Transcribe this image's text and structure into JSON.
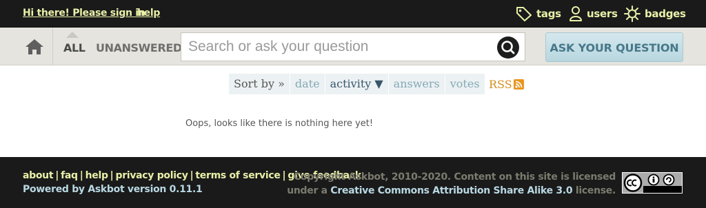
{
  "topbar": {
    "signin_label": "Hi there! Please sign in",
    "help_label": "help",
    "nav": [
      {
        "label": "tags",
        "icon": "tag-icon"
      },
      {
        "label": "users",
        "icon": "user-icon"
      },
      {
        "label": "badges",
        "icon": "badge-icon"
      }
    ]
  },
  "header": {
    "scopes": [
      {
        "label": "ALL",
        "active": true
      },
      {
        "label": "UNANSWERED",
        "active": false
      }
    ],
    "search_placeholder": "Search or ask your question",
    "ask_button_label": "ASK YOUR QUESTION"
  },
  "sortbar": {
    "label": "Sort by »",
    "options": [
      "date",
      "activity ▼",
      "answers",
      "votes"
    ],
    "active": "activity",
    "rss_label": "RSS"
  },
  "main": {
    "empty_message": "Oops, looks like there is nothing here yet!"
  },
  "footer": {
    "links": [
      "about",
      "faq",
      "help",
      "privacy policy",
      "terms of service",
      "give feedback"
    ],
    "powered_by": "Powered by Askbot version 0.11.1",
    "copyright_line1": "Copyright Askbot, 2010-2020. Content on this site is licensed",
    "copyright_line2_prefix": "under a",
    "license_link": "Creative Commons Attribution Share Alike 3.0",
    "copyright_line2_suffix": "license."
  },
  "colors": {
    "topbar_bg": "#1a1a1a",
    "link_yellow": "#e9f0a8",
    "header_bg": "#e5e4de",
    "ask_button_bg": "#c5e0e8",
    "rss_orange": "#e9961f"
  }
}
